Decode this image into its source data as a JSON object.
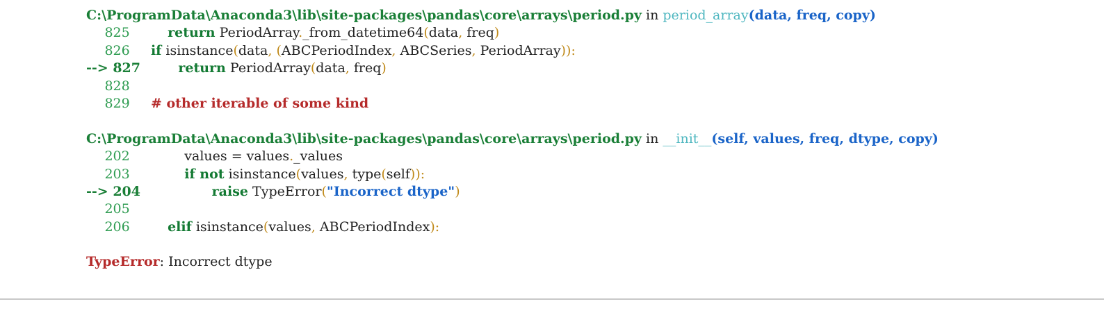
{
  "frames": [
    {
      "path": "C:\\ProgramData\\Anaconda3\\lib\\site-packages\\pandas\\core\\arrays\\period.py",
      "in_word": " in ",
      "func": "period_array",
      "sig": "(data, freq, copy)",
      "lines": [
        {
          "arrow": "    ",
          "num": "825",
          "indent": "         ",
          "kw": "return",
          "rest": " PeriodArray._from_datetime64(data, freq)"
        },
        {
          "arrow": "    ",
          "num": "826",
          "indent": "     ",
          "kw": "if",
          "rest": " isinstance(data, (ABCPeriodIndex, ABCSeries, PeriodArray)):"
        },
        {
          "arrow": "--> ",
          "num": "827",
          "indent": "         ",
          "kw": "return",
          "rest": " PeriodArray(data, freq)"
        },
        {
          "arrow": "    ",
          "num": "828",
          "indent": "",
          "kw": "",
          "rest": ""
        },
        {
          "arrow": "    ",
          "num": "829",
          "indent": "     ",
          "kw": "",
          "rest": "",
          "comment": "# other iterable of some kind"
        }
      ]
    },
    {
      "path": "C:\\ProgramData\\Anaconda3\\lib\\site-packages\\pandas\\core\\arrays\\period.py",
      "in_word": " in ",
      "func": "__init__",
      "sig": "(self, values, freq, dtype, copy)",
      "lines": [
        {
          "arrow": "    ",
          "num": "202",
          "indent": "             ",
          "kw": "",
          "rest": "values = values._values"
        },
        {
          "arrow": "    ",
          "num": "203",
          "indent": "             ",
          "kw": "if not",
          "rest": " isinstance(values, type(self)):"
        },
        {
          "arrow": "--> ",
          "num": "204",
          "indent": "                 ",
          "kw": "raise",
          "rest": " TypeError(",
          "string": "\"Incorrect dtype\"",
          "tail": ")"
        },
        {
          "arrow": "    ",
          "num": "205",
          "indent": "",
          "kw": "",
          "rest": ""
        },
        {
          "arrow": "    ",
          "num": "206",
          "indent": "         ",
          "kw": "elif",
          "rest": " isinstance(values, ABCPeriodIndex):"
        }
      ]
    }
  ],
  "error": {
    "type": "TypeError",
    "message": ": Incorrect dtype"
  },
  "colors": {
    "path": "#1a7f37",
    "func": "#4fb7c0",
    "args": "#1a64c8",
    "error": "#b52a2a",
    "punct": "#c08a1a"
  }
}
